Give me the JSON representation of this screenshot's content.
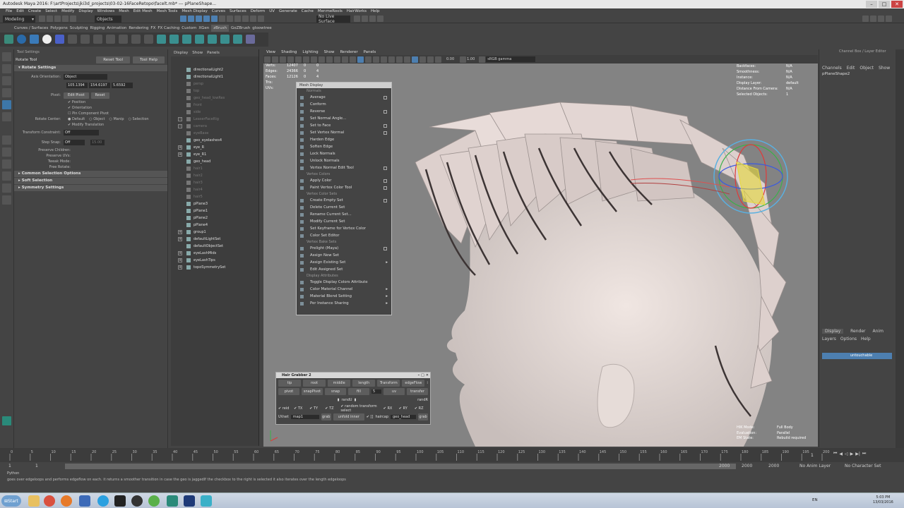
{
  "titlebar": {
    "title": "Autodesk Maya 2016: F:\\artProjects\\jki3d_projects\\03-02-16FaceRetopo\\facelt.mb*   ---   pPlaneShape..."
  },
  "menus": [
    "File",
    "Edit",
    "Create",
    "Select",
    "Modify",
    "Display",
    "Windows",
    "Mesh",
    "Edit Mesh",
    "Mesh Tools",
    "Mesh Display",
    "Curves",
    "Surfaces",
    "Deform",
    "UV",
    "Generate",
    "Cache",
    "MenmeRools",
    "HairWorks",
    "Help"
  ],
  "statusline": {
    "mode": "Modeling",
    "objects": "Objects",
    "live": "No Live Surface"
  },
  "shelf_tabs": [
    "Curves / Surfaces",
    "Polygons",
    "Sculpting",
    "Rigging",
    "Animation",
    "Rendering",
    "FX",
    "FX Caching",
    "Custom",
    "XGen",
    "zBrush",
    "GoZBrush",
    "gloowtree"
  ],
  "shelf_active": "zBrush",
  "tool_settings": {
    "header": "Tool Settings",
    "tool_name": "Rotate Tool",
    "reset": "Reset Tool",
    "help": "Tool Help",
    "section_rotate": "Rotate Settings",
    "axis_orient_label": "Axis Orientation:",
    "axis_orient_value": "Object",
    "xyz": [
      "105.1394",
      "154.6197",
      "5.6592"
    ],
    "pivot_label": "Pivot:",
    "edit_pivot": "Edit Pivot",
    "reset_pivot": "Reset",
    "chk_position": "Position",
    "chk_orientation": "Orientation",
    "chk_pin": "Pin Component Pivot",
    "rotate_center_label": "Rotate Center:",
    "rc_options": [
      "Default",
      "Object",
      "Manip",
      "Selection"
    ],
    "modify_translation": "Modify Translation",
    "transform_constraint_label": "Transform Constraint:",
    "transform_constraint_value": "Off",
    "step_snap_label": "Step Snap:",
    "step_snap_value": "Off",
    "step_snap_num": "15.00",
    "preserve_children": "Preserve Children:",
    "preserve_uvs": "Preserve UVs:",
    "tweak_mode": "Tweak Mode:",
    "free_rotate": "Free Rotate:",
    "sections": [
      "Common Selection Options",
      "Soft Selection",
      "Symmetry Settings"
    ]
  },
  "outliner": {
    "menu": [
      "Display",
      "Show",
      "Panels"
    ],
    "items": [
      {
        "name": "directionalLight2",
        "dim": false,
        "plus": false
      },
      {
        "name": "directionalLight1",
        "dim": false,
        "plus": false
      },
      {
        "name": "persp",
        "dim": true,
        "plus": false
      },
      {
        "name": "top",
        "dim": true,
        "plus": false
      },
      {
        "name": "geo_head_lowRes",
        "dim": true,
        "plus": false
      },
      {
        "name": "front",
        "dim": true,
        "plus": false
      },
      {
        "name": "side",
        "dim": true,
        "plus": false
      },
      {
        "name": "LeaserFaceRig",
        "dim": true,
        "plus": true
      },
      {
        "name": "camera",
        "dim": true,
        "plus": true
      },
      {
        "name": "eyeBase",
        "dim": true,
        "plus": false
      },
      {
        "name": "geo_eyelashes4",
        "dim": false,
        "plus": false
      },
      {
        "name": "eye_R",
        "dim": false,
        "plus": true
      },
      {
        "name": "eye_R1",
        "dim": false,
        "plus": true
      },
      {
        "name": "geo_head",
        "dim": false,
        "plus": false
      },
      {
        "name": "hair1",
        "dim": true,
        "plus": false
      },
      {
        "name": "hair2",
        "dim": true,
        "plus": false
      },
      {
        "name": "hair3",
        "dim": true,
        "plus": false
      },
      {
        "name": "hair4",
        "dim": true,
        "plus": false
      },
      {
        "name": "hair5",
        "dim": true,
        "plus": false
      },
      {
        "name": "pPlane3",
        "dim": false,
        "plus": false
      },
      {
        "name": "pPlane1",
        "dim": false,
        "plus": false
      },
      {
        "name": "pPlane2",
        "dim": false,
        "plus": false
      },
      {
        "name": "pPlane4",
        "dim": false,
        "plus": false
      },
      {
        "name": "group1",
        "dim": false,
        "plus": true
      },
      {
        "name": "defaultLightSet",
        "dim": false,
        "plus": true
      },
      {
        "name": "defaultObjectSet",
        "dim": false,
        "plus": false
      },
      {
        "name": "eyeLashMids",
        "dim": false,
        "plus": true
      },
      {
        "name": "eyeLashTips",
        "dim": false,
        "plus": true
      },
      {
        "name": "topoSymmetrySet",
        "dim": false,
        "plus": true
      }
    ]
  },
  "viewport": {
    "menu": [
      "View",
      "Shading",
      "Lighting",
      "Show",
      "Renderer",
      "Panels"
    ],
    "exposure": "0.00",
    "gamma": "1.00",
    "colorspace": "sRGB gamma",
    "hud_left": [
      {
        "k": "Verts:",
        "a": "12407",
        "b": "0",
        "c": "0"
      },
      {
        "k": "Edges:",
        "a": "24366",
        "b": "0",
        "c": "4"
      },
      {
        "k": "Faces:",
        "a": "12126",
        "b": "0",
        "c": "4"
      },
      {
        "k": "Tris:",
        "a": "",
        "b": "",
        "c": ""
      },
      {
        "k": "UVs:",
        "a": "",
        "b": "",
        "c": ""
      }
    ],
    "hud_right": [
      {
        "k": "Backfaces:",
        "v": "N/A"
      },
      {
        "k": "Smoothness:",
        "v": "N/A"
      },
      {
        "k": "Instance:",
        "v": "N/A"
      },
      {
        "k": "Display Layer:",
        "v": "default"
      },
      {
        "k": "Distance From Camera:",
        "v": "N/A"
      },
      {
        "k": "Selected Objects:",
        "v": "1"
      }
    ],
    "hud_bottom": [
      {
        "k": "HIK Mode:",
        "v": "Full Body"
      },
      {
        "k": "Evaluation:",
        "v": "Parallel"
      },
      {
        "k": "EM State:",
        "v": "Rebuild required"
      }
    ]
  },
  "popup": {
    "title": "Mesh Display",
    "items": [
      {
        "t": "s",
        "label": "Normals"
      },
      {
        "t": "i",
        "label": "Average",
        "box": true
      },
      {
        "t": "i",
        "label": "Conform",
        "box": false
      },
      {
        "t": "i",
        "label": "Reverse",
        "box": true
      },
      {
        "t": "i",
        "label": "Set Normal Angle...",
        "box": false
      },
      {
        "t": "i",
        "label": "Set to Face",
        "box": true
      },
      {
        "t": "i",
        "label": "Set Vertex Normal",
        "box": true
      },
      {
        "t": "i",
        "label": "Harden Edge",
        "box": false
      },
      {
        "t": "i",
        "label": "Soften Edge",
        "box": false
      },
      {
        "t": "i",
        "label": "Lock Normals",
        "box": false
      },
      {
        "t": "i",
        "label": "Unlock Normals",
        "box": false
      },
      {
        "t": "i",
        "label": "Vertex Normal Edit Tool",
        "box": true
      },
      {
        "t": "s",
        "label": "Vertex Colors"
      },
      {
        "t": "i",
        "label": "Apply Color",
        "box": true
      },
      {
        "t": "i",
        "label": "Paint Vertex Color Tool",
        "box": true
      },
      {
        "t": "s",
        "label": "Vertex Color Sets"
      },
      {
        "t": "i",
        "label": "Create Empty Set",
        "box": true
      },
      {
        "t": "i",
        "label": "Delete Current Set",
        "box": false
      },
      {
        "t": "i",
        "label": "Rename Current Set...",
        "box": false
      },
      {
        "t": "i",
        "label": "Modify Current Set",
        "box": false
      },
      {
        "t": "i",
        "label": "Set Keyframe for Vertex Color",
        "box": false
      },
      {
        "t": "i",
        "label": "Color Set Editor",
        "box": false
      },
      {
        "t": "s",
        "label": "Vertex Bake Sets"
      },
      {
        "t": "i",
        "label": "Prelight (Maya)",
        "box": true
      },
      {
        "t": "i",
        "label": "Assign New Set",
        "box": false
      },
      {
        "t": "i",
        "label": "Assign Existing Set",
        "arrow": true
      },
      {
        "t": "i",
        "label": "Edit Assigned Set",
        "box": false
      },
      {
        "t": "s",
        "label": "Display Attributes"
      },
      {
        "t": "i",
        "label": "Toggle Display Colors Attribute",
        "box": false
      },
      {
        "t": "i",
        "label": "Color Material Channel",
        "arrow": true
      },
      {
        "t": "i",
        "label": "Material Blend Setting",
        "arrow": true
      },
      {
        "t": "i",
        "label": "Per Instance Sharing",
        "arrow": true
      }
    ]
  },
  "hair_grabber": {
    "title": "Hair Grabber 2",
    "row1": [
      "tip",
      "root",
      "middle",
      "length",
      "Transform",
      "edgeFlow"
    ],
    "row2": [
      "pivot",
      "snapPivot",
      "snap",
      "fill",
      "5",
      "uv",
      "transfer"
    ],
    "row3_label": "randU",
    "row3b_label": "randR",
    "row4": [
      "reid",
      "TX",
      "TY",
      "TZ",
      "random transform select",
      "RX",
      "RY",
      "RZ"
    ],
    "uvset_label": "UVset",
    "uvset_value": "map1",
    "grab": "grab",
    "unfold": "unfold inner",
    "haircap": "haircap",
    "geo": "geo_head",
    "grab2": "grab"
  },
  "channel_box": {
    "header": "Channel Box / Layer Editor",
    "menu": [
      "Channels",
      "Edit",
      "Object",
      "Show"
    ],
    "object": "pPlaneShape2"
  },
  "layers": {
    "tabs": [
      "Display",
      "Render",
      "Anim"
    ],
    "menu": [
      "Layers",
      "Options",
      "Help"
    ],
    "layer": "untouchable"
  },
  "timeline": {
    "ticks": [
      "0",
      "5",
      "10",
      "15",
      "20",
      "25",
      "30",
      "35",
      "40",
      "45",
      "50",
      "55",
      "60",
      "65",
      "70",
      "75",
      "80",
      "85",
      "90",
      "95",
      "100",
      "105",
      "110",
      "115",
      "120",
      "125",
      "130",
      "135",
      "140",
      "145",
      "150",
      "155",
      "160",
      "165",
      "170",
      "175",
      "180",
      "185",
      "190",
      "195",
      "200"
    ],
    "current": "1"
  },
  "range": {
    "start": "1",
    "startb": "1",
    "end": "2000",
    "endb": "2000",
    "max": "2000",
    "anim_layer": "No Anim Layer",
    "char_set": "No Character Set"
  },
  "helpline": {
    "text": "goes over edgeloops and performs edgeflow on each. it returns a smoother transition in case the geo is jaggedIf the checkbox to the right is selected it also iterates over the length edgeloops",
    "python": "Python"
  },
  "taskbar": {
    "start": "Start",
    "lang": "EN",
    "time": "5:03 PM",
    "date": "13/03/2016"
  },
  "colors": {
    "accent": "#4d7fb0",
    "bg": "#444444",
    "viewport": "#838383"
  }
}
